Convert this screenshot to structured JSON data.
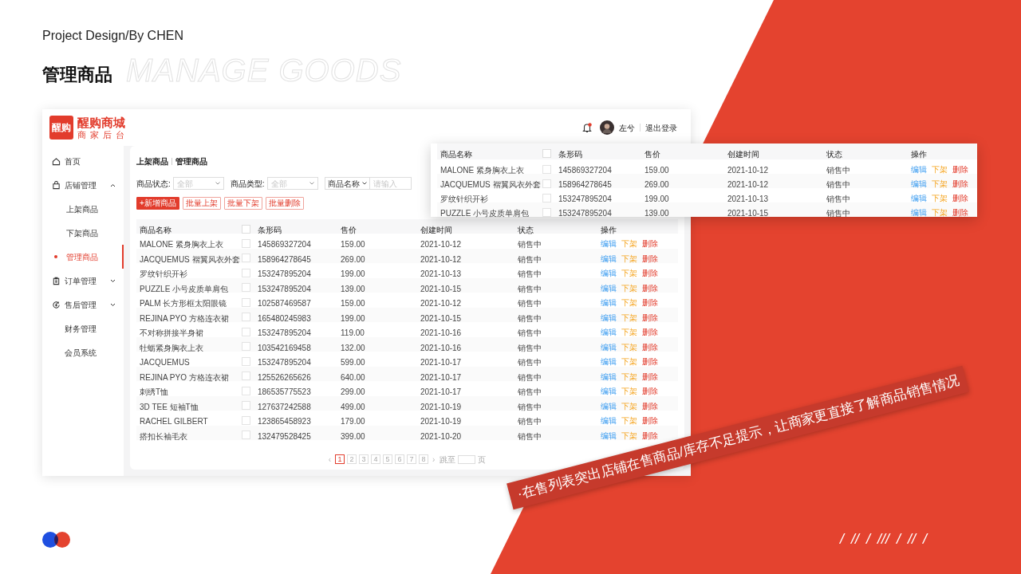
{
  "slide": {
    "subtitle": "Project Design/By CHEN",
    "title": "管理商品",
    "watermark": "MANAGE GOODS",
    "slashes": [
      "/",
      "//",
      "/",
      "///",
      "/",
      "//",
      "/"
    ]
  },
  "app": {
    "brand": {
      "logo": "醒购",
      "name": "醒购商城",
      "tagline": "商 家 后 台"
    },
    "header": {
      "has_unread": true,
      "user": "左兮",
      "logout": "退出登录"
    },
    "sidebar": {
      "items": [
        {
          "label": "首页",
          "selected": false
        },
        {
          "label": "店铺管理",
          "selected": false,
          "expanded": true,
          "children": [
            {
              "label": "上架商品",
              "selected": false
            },
            {
              "label": "下架商品",
              "selected": false
            },
            {
              "label": "管理商品",
              "selected": true
            }
          ]
        },
        {
          "label": "订单管理",
          "selected": false,
          "expanded": false
        },
        {
          "label": "售后管理",
          "selected": false,
          "expanded": false
        },
        {
          "label": "财务管理",
          "selected": false
        },
        {
          "label": "会员系统",
          "selected": false
        }
      ]
    },
    "breadcrumb": [
      "上架商品",
      "管理商品"
    ],
    "filters": [
      {
        "label": "商品状态:",
        "placeholder": "全部"
      },
      {
        "label": "商品类型:",
        "placeholder": "全部"
      }
    ],
    "search": {
      "field": "商品名称",
      "placeholder": "请输入"
    },
    "buttons": [
      {
        "label": "+新增商品",
        "kind": "primary"
      },
      {
        "label": "批量上架",
        "kind": "outline"
      },
      {
        "label": "批量下架",
        "kind": "outline"
      },
      {
        "label": "批量删除",
        "kind": "outline"
      }
    ],
    "table": {
      "columns": [
        "商品名称",
        "条形码",
        "售价",
        "创建时间",
        "状态",
        "操作"
      ],
      "select_all": {
        "checked": false
      },
      "rows": [
        {
          "name": "MALONE 紧身胸衣上衣",
          "checked": false,
          "barcode": "145869327204",
          "price": "159.00",
          "date": "2021-10-12",
          "status": "销售中",
          "actions": [
            {
              "kind": "edit",
              "label": "编辑"
            },
            {
              "kind": "offline",
              "label": "下架"
            },
            {
              "kind": "delete",
              "label": "删除"
            }
          ]
        },
        {
          "name": "JACQUEMUS 褶翼风衣外套",
          "checked": false,
          "barcode": "158964278645",
          "price": "269.00",
          "date": "2021-10-12",
          "status": "销售中",
          "actions": [
            {
              "kind": "edit",
              "label": "编辑"
            },
            {
              "kind": "offline",
              "label": "下架"
            },
            {
              "kind": "delete",
              "label": "删除"
            }
          ]
        },
        {
          "name": "罗纹针织开衫",
          "checked": false,
          "barcode": "153247895204",
          "price": "199.00",
          "date": "2021-10-13",
          "status": "销售中",
          "actions": [
            {
              "kind": "edit",
              "label": "编辑"
            },
            {
              "kind": "offline",
              "label": "下架"
            },
            {
              "kind": "delete",
              "label": "删除"
            }
          ]
        },
        {
          "name": "PUZZLE 小号皮质单肩包",
          "checked": false,
          "barcode": "153247895204",
          "price": "139.00",
          "date": "2021-10-15",
          "status": "销售中",
          "actions": [
            {
              "kind": "edit",
              "label": "编辑"
            },
            {
              "kind": "offline",
              "label": "下架"
            },
            {
              "kind": "delete",
              "label": "删除"
            }
          ]
        },
        {
          "name": "PALM 长方形框太阳眼镜",
          "checked": false,
          "barcode": "102587469587",
          "price": "159.00",
          "date": "2021-10-12",
          "status": "销售中",
          "actions": [
            {
              "kind": "edit",
              "label": "编辑"
            },
            {
              "kind": "offline",
              "label": "下架"
            },
            {
              "kind": "delete",
              "label": "删除"
            }
          ]
        },
        {
          "name": "REJINA PYO 方格连衣裙",
          "checked": false,
          "barcode": "165480245983",
          "price": "199.00",
          "date": "2021-10-15",
          "status": "销售中",
          "actions": [
            {
              "kind": "edit",
              "label": "编辑"
            },
            {
              "kind": "offline",
              "label": "下架"
            },
            {
              "kind": "delete",
              "label": "删除"
            }
          ]
        },
        {
          "name": "不对称拼接半身裙",
          "checked": false,
          "barcode": "153247895204",
          "price": "119.00",
          "date": "2021-10-16",
          "status": "销售中",
          "actions": [
            {
              "kind": "edit",
              "label": "编辑"
            },
            {
              "kind": "offline",
              "label": "下架"
            },
            {
              "kind": "delete",
              "label": "删除"
            }
          ]
        },
        {
          "name": "牡蛎紧身胸衣上衣",
          "checked": false,
          "barcode": "103542169458",
          "price": "132.00",
          "date": "2021-10-16",
          "status": "销售中",
          "actions": [
            {
              "kind": "edit",
              "label": "编辑"
            },
            {
              "kind": "offline",
              "label": "下架"
            },
            {
              "kind": "delete",
              "label": "删除"
            }
          ]
        },
        {
          "name": "JACQUEMUS",
          "checked": false,
          "barcode": "153247895204",
          "price": "599.00",
          "date": "2021-10-17",
          "status": "销售中",
          "actions": [
            {
              "kind": "edit",
              "label": "编辑"
            },
            {
              "kind": "offline",
              "label": "下架"
            },
            {
              "kind": "delete",
              "label": "删除"
            }
          ]
        },
        {
          "name": "REJINA PYO 方格连衣裙",
          "checked": false,
          "barcode": "125526265626",
          "price": "640.00",
          "date": "2021-10-17",
          "status": "销售中",
          "actions": [
            {
              "kind": "edit",
              "label": "编辑"
            },
            {
              "kind": "offline",
              "label": "下架"
            },
            {
              "kind": "delete",
              "label": "删除"
            }
          ]
        },
        {
          "name": "刺绣T恤",
          "checked": false,
          "barcode": "186535775523",
          "price": "299.00",
          "date": "2021-10-17",
          "status": "销售中",
          "actions": [
            {
              "kind": "edit",
              "label": "编辑"
            },
            {
              "kind": "offline",
              "label": "下架"
            },
            {
              "kind": "delete",
              "label": "删除"
            }
          ]
        },
        {
          "name": "3D TEE 短袖T恤",
          "checked": false,
          "barcode": "127637242588",
          "price": "499.00",
          "date": "2021-10-19",
          "status": "销售中",
          "actions": [
            {
              "kind": "edit",
              "label": "编辑"
            },
            {
              "kind": "offline",
              "label": "下架"
            },
            {
              "kind": "delete",
              "label": "删除"
            }
          ]
        },
        {
          "name": "RACHEL GILBERT",
          "checked": false,
          "barcode": "123865458923",
          "price": "179.00",
          "date": "2021-10-19",
          "status": "销售中",
          "actions": [
            {
              "kind": "edit",
              "label": "编辑"
            },
            {
              "kind": "offline",
              "label": "下架"
            },
            {
              "kind": "delete",
              "label": "删除"
            }
          ]
        },
        {
          "name": "搭扣长袖毛衣",
          "checked": false,
          "barcode": "132479528425",
          "price": "399.00",
          "date": "2021-10-20",
          "status": "销售中",
          "actions": [
            {
              "kind": "edit",
              "label": "编辑"
            },
            {
              "kind": "offline",
              "label": "下架"
            },
            {
              "kind": "delete",
              "label": "删除"
            }
          ]
        }
      ]
    },
    "pagination": {
      "prev": "‹",
      "pages": [
        {
          "label": "1",
          "selected": true
        },
        {
          "label": "2",
          "selected": false
        },
        {
          "label": "3",
          "selected": false
        },
        {
          "label": "4",
          "selected": false
        },
        {
          "label": "5",
          "selected": false
        },
        {
          "label": "6",
          "selected": false
        },
        {
          "label": "7",
          "selected": false
        },
        {
          "label": "8",
          "selected": false
        }
      ],
      "next": "›",
      "jump_label": "跳至",
      "page_suffix": "页"
    }
  },
  "popup_table": {
    "columns": [
      "商品名称",
      "条形码",
      "售价",
      "创建时间",
      "状态",
      "操作"
    ],
    "select_all": {
      "checked": false
    },
    "rows": [
      {
        "name": "MALONE 紧身胸衣上衣",
        "checked": false,
        "barcode": "145869327204",
        "price": "159.00",
        "date": "2021-10-12",
        "status": "销售中",
        "actions": [
          {
            "kind": "edit",
            "label": "编辑"
          },
          {
            "kind": "offline",
            "label": "下架"
          },
          {
            "kind": "delete",
            "label": "删除"
          }
        ]
      },
      {
        "name": "JACQUEMUS 褶翼风衣外套",
        "checked": false,
        "barcode": "158964278645",
        "price": "269.00",
        "date": "2021-10-12",
        "status": "销售中",
        "actions": [
          {
            "kind": "edit",
            "label": "编辑"
          },
          {
            "kind": "offline",
            "label": "下架"
          },
          {
            "kind": "delete",
            "label": "删除"
          }
        ]
      },
      {
        "name": "罗纹针织开衫",
        "checked": false,
        "barcode": "153247895204",
        "price": "199.00",
        "date": "2021-10-13",
        "status": "销售中",
        "actions": [
          {
            "kind": "edit",
            "label": "编辑"
          },
          {
            "kind": "offline",
            "label": "下架"
          },
          {
            "kind": "delete",
            "label": "删除"
          }
        ]
      },
      {
        "name": "PUZZLE 小号皮质单肩包",
        "checked": false,
        "barcode": "153247895204",
        "price": "139.00",
        "date": "2021-10-15",
        "status": "销售中",
        "actions": [
          {
            "kind": "edit",
            "label": "编辑"
          },
          {
            "kind": "offline",
            "label": "下架"
          },
          {
            "kind": "delete",
            "label": "删除"
          }
        ]
      }
    ]
  },
  "callout": "·在售列表突出店铺在售商品/库存不足提示，让商家更直接了解商品销售情况"
}
